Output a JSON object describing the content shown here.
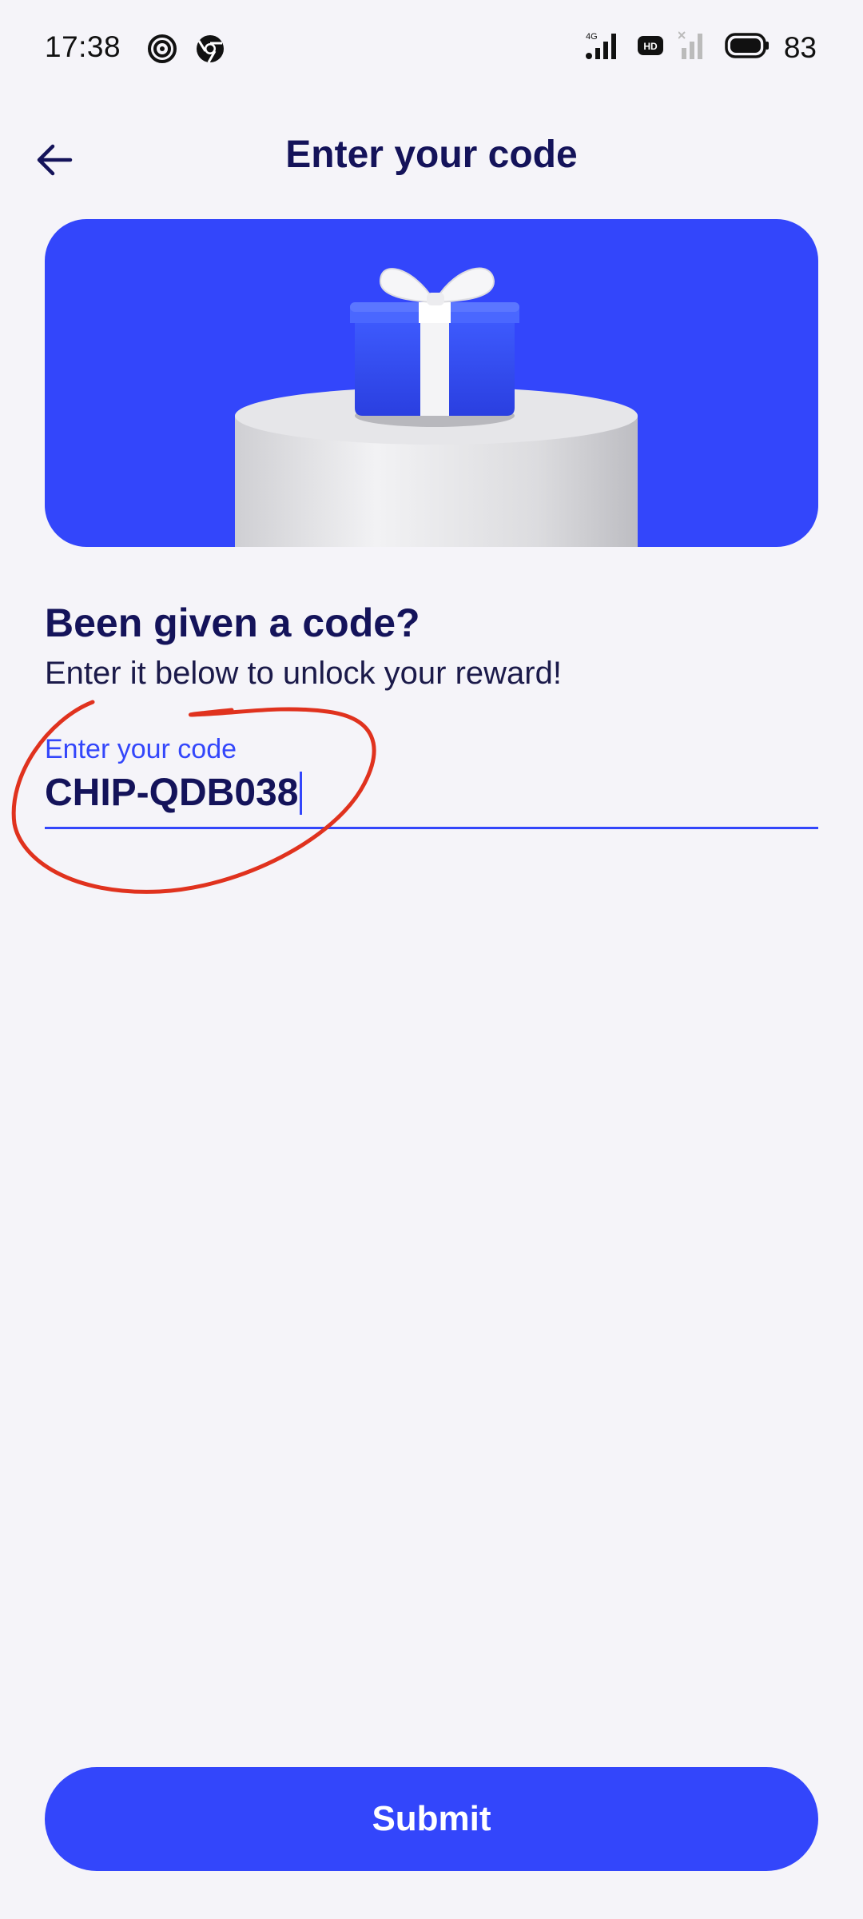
{
  "status_bar": {
    "time": "17:38",
    "network_type": "4G",
    "hd_badge": "HD",
    "battery_level": "83",
    "icons": [
      "target-icon",
      "chrome-icon",
      "signal-icon",
      "hd-icon",
      "signal-weak-icon",
      "battery-icon"
    ]
  },
  "header": {
    "title": "Enter your code",
    "back_icon": "arrow-left-icon"
  },
  "banner": {
    "image": "gift-box-on-pedestal",
    "background_color": "#3346fb"
  },
  "content": {
    "headline": "Been given a code?",
    "subline": "Enter it below to unlock your reward!"
  },
  "code_input": {
    "label": "Enter your code",
    "value": "CHIP-QDB038"
  },
  "actions": {
    "submit_label": "Submit"
  },
  "colors": {
    "accent": "#3346fb",
    "text_dark": "#14135a",
    "background": "#f5f4f9",
    "annotation": "#e0321e"
  }
}
